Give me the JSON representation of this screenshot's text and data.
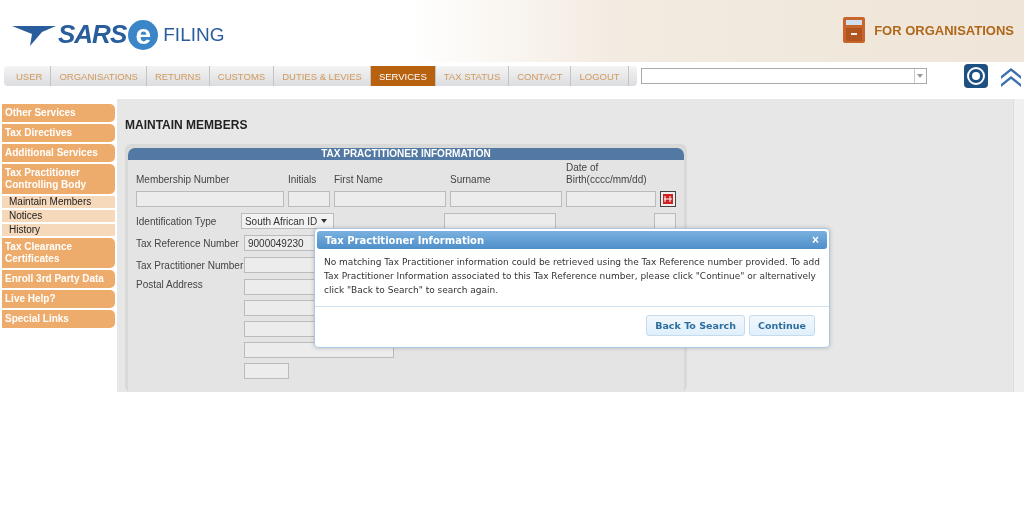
{
  "header": {
    "logo": {
      "brand": "SARS",
      "e_letter": "e",
      "product": "FILING"
    },
    "badge": "FOR ORGANISATIONS"
  },
  "nav": {
    "tabs": [
      {
        "label": "USER",
        "selected": false
      },
      {
        "label": "ORGANISATIONS",
        "selected": false
      },
      {
        "label": "RETURNS",
        "selected": false
      },
      {
        "label": "CUSTOMS",
        "selected": false
      },
      {
        "label": "DUTIES & LEVIES",
        "selected": false
      },
      {
        "label": "SERVICES",
        "selected": true
      },
      {
        "label": "TAX STATUS",
        "selected": false
      },
      {
        "label": "CONTACT",
        "selected": false
      },
      {
        "label": "LOGOUT",
        "selected": false
      }
    ]
  },
  "sidebar": {
    "items": [
      {
        "label": "Other Services"
      },
      {
        "label": "Tax Directives"
      },
      {
        "label": "Additional Services"
      },
      {
        "label": "Tax Practitioner Controlling Body",
        "children": [
          {
            "label": "Maintain Members"
          },
          {
            "label": "Notices"
          },
          {
            "label": "History"
          }
        ]
      },
      {
        "label": "Tax Clearance Certificates"
      },
      {
        "label": "Enroll 3rd Party Data"
      },
      {
        "label": "Live Help?"
      },
      {
        "label": "Special Links"
      }
    ]
  },
  "page_title": "MAINTAIN MEMBERS",
  "form": {
    "section_title": "TAX PRACTITIONER INFORMATION",
    "columns": [
      {
        "label": "Membership Number"
      },
      {
        "label": "Initials"
      },
      {
        "label": "First Name"
      },
      {
        "label": "Surname"
      },
      {
        "label": "Date of Birth(cccc/mm/dd)"
      }
    ],
    "identification_type": {
      "label": "Identification Type",
      "value": "South African ID"
    },
    "tax_reference": {
      "label": "Tax Reference Number",
      "value": "9000049230"
    },
    "practitioner_number": {
      "label": "Tax Practitioner Number"
    },
    "postal_address": {
      "label": "Postal Address"
    }
  },
  "dialog": {
    "title": "Tax Practitioner Information",
    "close": "×",
    "message": "No matching Tax Practitioner information could be retrieved using the Tax Reference number provided. To add Tax Practitioner Information associated to this Tax Reference number, please click \"Continue\" or alternatively click \"Back to Search\" to search again.",
    "buttons": [
      "Back To Search",
      "Continue"
    ]
  }
}
